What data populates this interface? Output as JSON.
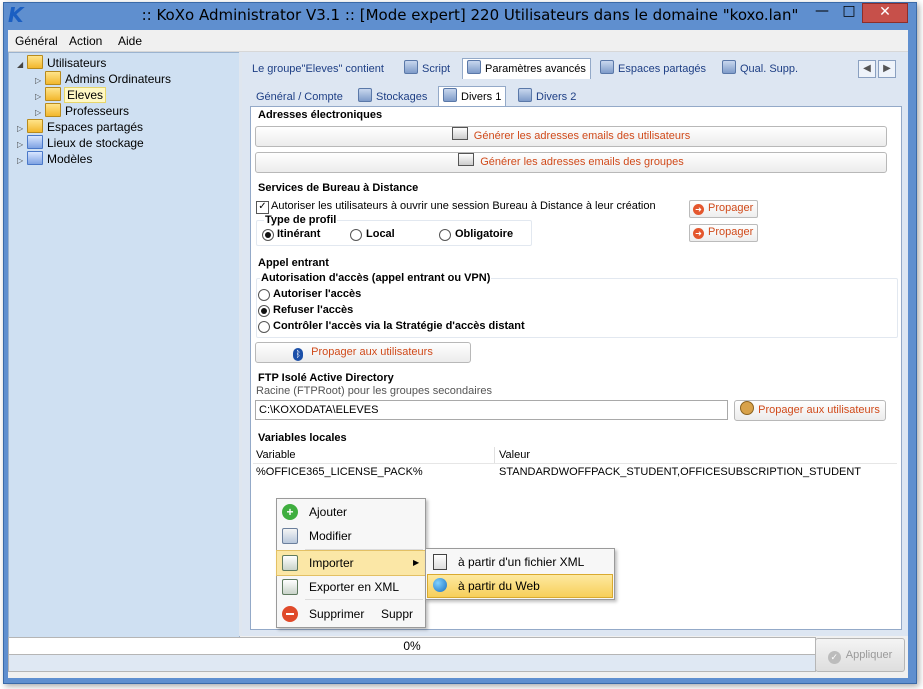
{
  "window": {
    "title": ":: KoXo Administrator V3.1 :: [Mode expert] 220 Utilisateurs dans le domaine \"koxo.lan\"",
    "min_glyph": "—",
    "max_glyph": "□",
    "close_glyph": "✕"
  },
  "menubar": {
    "items": [
      "Général",
      "Action",
      "Aide"
    ]
  },
  "tree": {
    "nodes": [
      {
        "label": "Utilisateurs",
        "expanded": true
      },
      {
        "label": "Admins Ordinateurs"
      },
      {
        "label": "Eleves",
        "selected": true
      },
      {
        "label": "Professeurs"
      },
      {
        "label": "Espaces partagés"
      },
      {
        "label": "Lieux de stockage"
      },
      {
        "label": "Modèles"
      }
    ]
  },
  "tabs_top": [
    "Le groupe\"Eleves\" contient",
    "Script",
    "Paramètres avancés",
    "Espaces partagés",
    "Qual. Supp."
  ],
  "tabs_top_active": "Paramètres avancés",
  "tabs_sub": [
    "Général / Compte",
    "Stockages",
    "Divers 1",
    "Divers 2"
  ],
  "tabs_sub_active": "Divers 1",
  "emails": {
    "title": "Adresses électroniques",
    "btn_users": "Générer les adresses emails des utilisateurs",
    "btn_groups": "Générer les adresses emails des groupes"
  },
  "rds": {
    "title": "Services de Bureau à Distance",
    "allow_label": "Autoriser les utilisateurs à ouvrir une session Bureau à Distance à leur création",
    "allow_checked": true,
    "profile_title": "Type de profil",
    "profile_options": [
      "Itinérant",
      "Local",
      "Obligatoire"
    ],
    "profile_selected": "Itinérant",
    "propagate_1": "Propager",
    "propagate_2": "Propager"
  },
  "dialin": {
    "title": "Appel entrant",
    "access_title": "Autorisation d'accès (appel entrant ou VPN)",
    "options": [
      "Autoriser l'accès",
      "Refuser l'accès",
      "Contrôler l'accès via la Stratégie d'accès distant"
    ],
    "selected": "Refuser l'accès",
    "propagate_btn": "Propager aux utilisateurs"
  },
  "ftp": {
    "title": "FTP Isolé Active Directory",
    "hint": "Racine (FTPRoot) pour les groupes secondaires",
    "path_value": "C:\\KOXODATA\\ELEVES",
    "propagate_btn": "Propager aux utilisateurs"
  },
  "localvars": {
    "title": "Variables locales",
    "columns": [
      "Variable",
      "Valeur"
    ],
    "rows": [
      {
        "variable": "%OFFICE365_LICENSE_PACK%",
        "value": "STANDARDWOFFPACK_STUDENT,OFFICESUBSCRIPTION_STUDENT"
      }
    ]
  },
  "context_menu": {
    "items": [
      {
        "label": "Ajouter",
        "shortcut": ""
      },
      {
        "label": "Modifier",
        "shortcut": ""
      },
      {
        "label": "Importer",
        "shortcut": ""
      },
      {
        "label": "Exporter en XML",
        "shortcut": ""
      },
      {
        "label": "Supprimer",
        "shortcut": "Suppr"
      }
    ],
    "submenu": [
      {
        "label": "à partir d'un fichier XML"
      },
      {
        "label": "à partir du Web",
        "highlighted": true
      }
    ]
  },
  "status": {
    "progress_text": "0%",
    "progress": 0,
    "apply_label": "Appliquer"
  },
  "colors": {
    "accent": "#5f8fcf",
    "link_orange": "#d04a1a",
    "tree_bg": "#cfe0f2",
    "highlight": "#f7cf5a"
  }
}
